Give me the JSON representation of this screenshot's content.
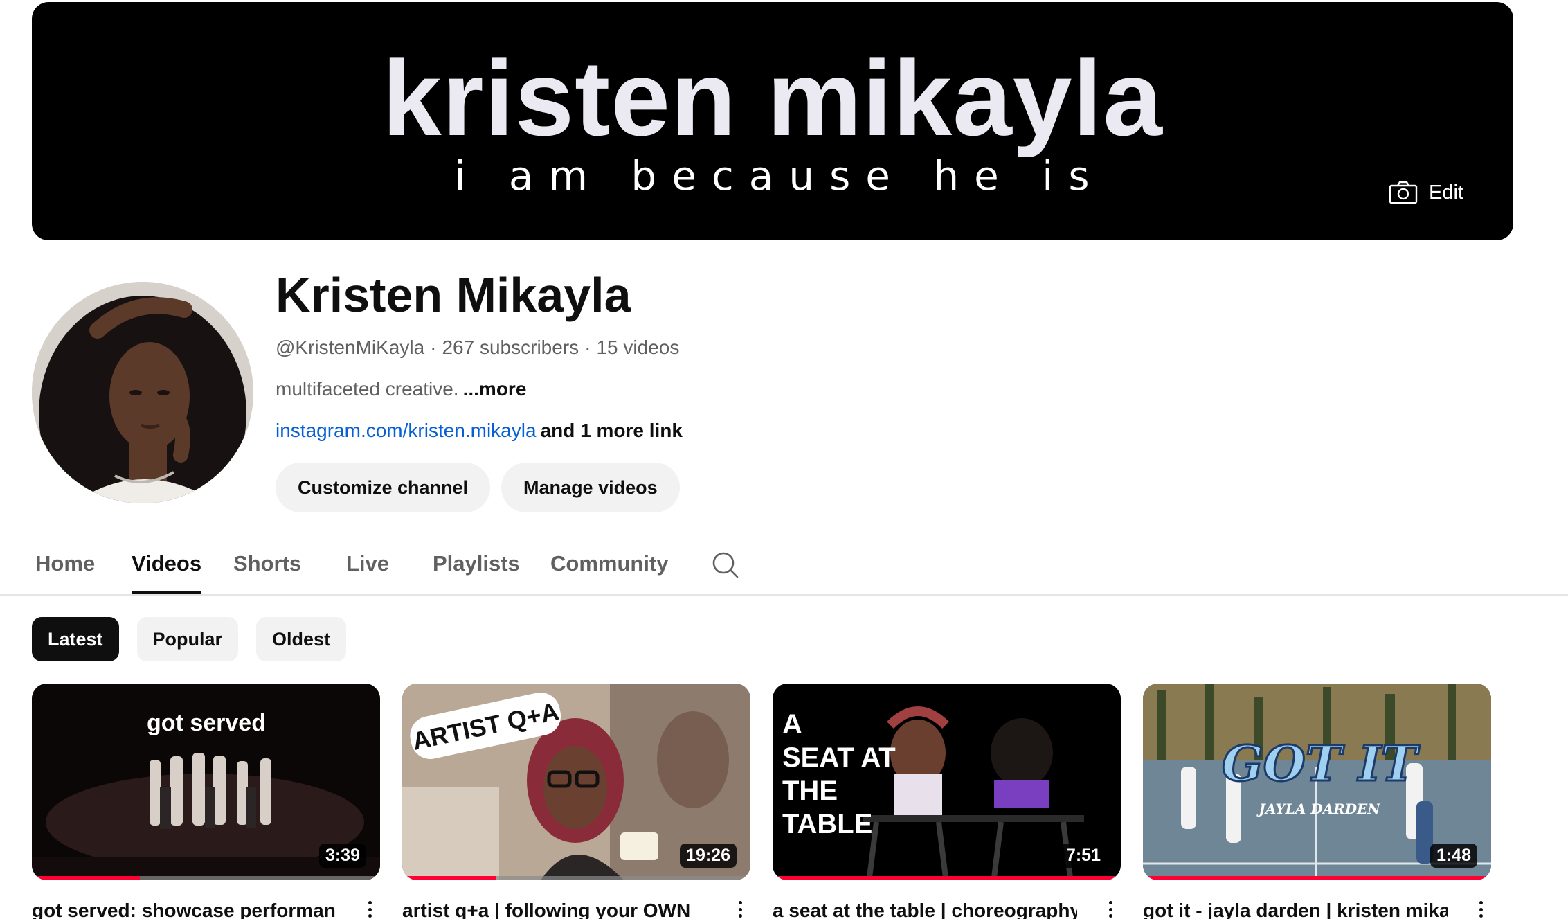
{
  "banner": {
    "title": "kristen mikayla",
    "subtitle": "i am because he is",
    "edit_label": "Edit",
    "edit_icon": "camera-icon"
  },
  "channel": {
    "name": "Kristen Mikayla",
    "handle": "@KristenMiKayla",
    "subscribers": "267 subscribers",
    "video_count": "15 videos",
    "separator": "·",
    "description": "multifaceted creative.",
    "description_more": "...more",
    "link": "instagram.com/kristen.mikayla",
    "more_links": "and 1 more link",
    "customize_label": "Customize channel",
    "manage_label": "Manage videos"
  },
  "tabs": [
    {
      "label": "Home"
    },
    {
      "label": "Videos"
    },
    {
      "label": "Shorts"
    },
    {
      "label": "Live"
    },
    {
      "label": "Playlists"
    },
    {
      "label": "Community"
    }
  ],
  "active_tab": "Videos",
  "chips": [
    {
      "label": "Latest"
    },
    {
      "label": "Popular"
    },
    {
      "label": "Oldest"
    }
  ],
  "active_chip": "Latest",
  "videos": [
    {
      "title": "got served: showcase performance |",
      "duration": "3:39",
      "thumb_text": "got served",
      "watch_progress": 0.31
    },
    {
      "title": "artist q+a | following your OWN",
      "duration": "19:26",
      "thumb_text": "ARTIST Q+A",
      "watch_progress": 0.27
    },
    {
      "title": "a seat at the table | choreography",
      "duration": "7:51",
      "thumb_text_lines": [
        "A",
        "SEAT AT",
        "THE",
        "TABLE"
      ],
      "watch_progress": 1.0
    },
    {
      "title": "got it - jayla darden | kristen mikayla",
      "duration": "1:48",
      "thumb_text": "GOT IT",
      "thumb_subtext": "JAYLA DARDEN",
      "watch_progress": 1.0
    }
  ],
  "colors": {
    "accent_link": "#065fd4",
    "progress_red": "#ff0033",
    "chip_bg": "#f2f2f2",
    "text_secondary": "#606060"
  }
}
